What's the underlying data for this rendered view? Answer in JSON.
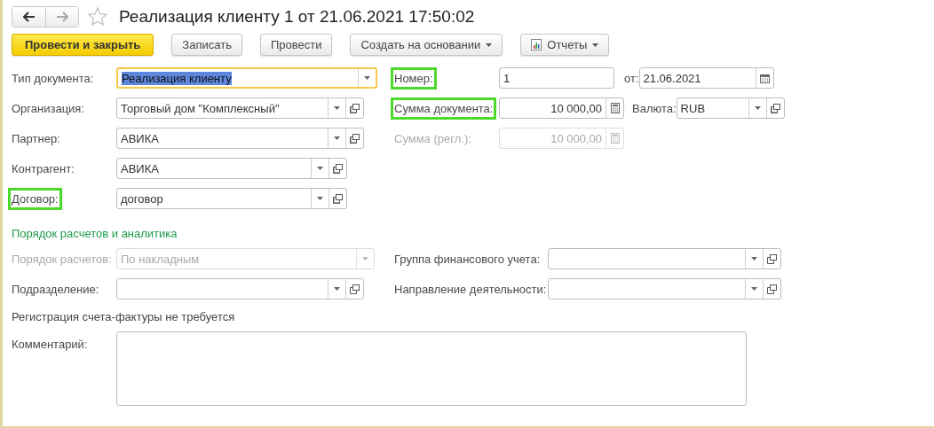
{
  "window": {
    "title": "Реализация клиенту 1 от 21.06.2021 17:50:02",
    "favorite": false
  },
  "nav": [
    {
      "kind": "back",
      "disabled": false
    },
    {
      "kind": "forward",
      "disabled": true
    }
  ],
  "toolbar": [
    {
      "label": "Провести и закрыть",
      "kind": "primary",
      "dropdown": false
    },
    {
      "label": "Записать",
      "kind": "plain",
      "dropdown": false
    },
    {
      "label": "Провести",
      "kind": "plain",
      "dropdown": false
    },
    {
      "label": "Создать на основании",
      "kind": "plain",
      "dropdown": true
    },
    {
      "label": "Отчеты",
      "kind": "reports",
      "dropdown": true
    }
  ],
  "header_rows": [
    {
      "fields": [
        {
          "label": "Тип документа:",
          "value": "Реализация клиенту",
          "kind": "select",
          "open_button": false,
          "focused": true,
          "disabled": false,
          "highlighted": false
        },
        {
          "label": "Номер:",
          "value": "1",
          "kind": "text",
          "open_button": false,
          "focused": false,
          "disabled": false,
          "highlighted": true
        },
        {
          "label": "от:",
          "value": "21.06.2021",
          "kind": "date",
          "open_button": false,
          "focused": false,
          "disabled": false,
          "highlighted": false
        }
      ]
    },
    {
      "fields": [
        {
          "label": "Организация:",
          "value": "Торговый дом \"Комплексный\"",
          "kind": "select",
          "open_button": true,
          "focused": false,
          "disabled": false,
          "highlighted": false
        },
        {
          "label": "Сумма документа:",
          "value": "10 000,00",
          "kind": "number",
          "open_button": false,
          "focused": false,
          "disabled": false,
          "highlighted": true
        },
        {
          "label": "Валюта:",
          "value": "RUB",
          "kind": "select",
          "open_button": true,
          "focused": false,
          "disabled": false,
          "highlighted": false
        }
      ]
    },
    {
      "fields": [
        {
          "label": "Партнер:",
          "value": "АВИКА",
          "kind": "select",
          "open_button": true,
          "focused": false,
          "disabled": false,
          "highlighted": false
        },
        {
          "label": "Сумма (регл.):",
          "value": "10 000,00",
          "kind": "number",
          "open_button": false,
          "focused": false,
          "disabled": true,
          "highlighted": false
        }
      ]
    },
    {
      "fields": [
        {
          "label": "Контрагент:",
          "value": "АВИКА",
          "kind": "select",
          "open_button": true,
          "focused": false,
          "disabled": false,
          "highlighted": false
        }
      ]
    },
    {
      "fields": [
        {
          "label": "Договор:",
          "value": "договор",
          "kind": "select",
          "open_button": true,
          "focused": false,
          "disabled": false,
          "highlighted": true
        }
      ]
    }
  ],
  "settlement": {
    "title": "Порядок расчетов и аналитика",
    "rows": [
      {
        "fields": [
          {
            "label": "Порядок расчетов:",
            "value": "По накладным",
            "kind": "select",
            "open_button": false,
            "focused": false,
            "disabled": true,
            "highlighted": false
          },
          {
            "label": "Группа финансового учета:",
            "kind": "select",
            "open_button": true,
            "focused": false,
            "disabled": false,
            "highlighted": false
          }
        ]
      },
      {
        "fields": [
          {
            "label": "Подразделение:",
            "kind": "select",
            "open_button": true,
            "focused": false,
            "disabled": false,
            "highlighted": false
          },
          {
            "label": "Направление деятельности:",
            "kind": "select",
            "open_button": true,
            "focused": false,
            "disabled": false,
            "highlighted": false
          }
        ]
      }
    ]
  },
  "invoice_note": "Регистрация счета-фактуры не требуется",
  "comment": {
    "label": "Комментарий:"
  }
}
